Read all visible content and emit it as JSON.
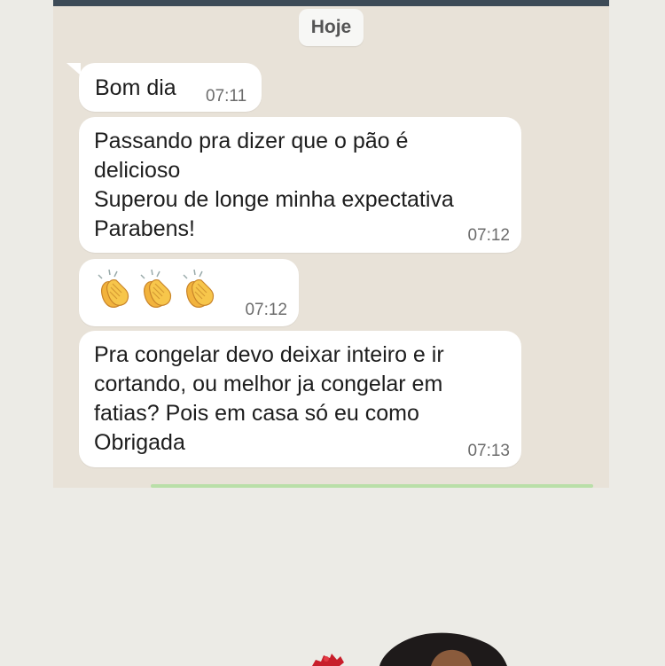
{
  "chat": {
    "date_chip": "Hoje",
    "messages": [
      {
        "text": "Bom dia",
        "time": "07:11"
      },
      {
        "text": "Passando pra dizer que o pão é\ndelicioso\nSuperou de longe minha expectativa\nParabens!",
        "time": "07:12"
      },
      {
        "text": "",
        "emoji": "clapping-hands",
        "count": 3,
        "time": "07:12"
      },
      {
        "text": "Pra congelar devo deixar inteiro e ir\ncortando, ou melhor ja congelar em\nfatias? Pois em casa só eu como\nObrigada",
        "time": "07:13"
      }
    ]
  },
  "colors": {
    "header": "#3d4b57",
    "chat_background": "#e8e2d8",
    "bubble": "#ffffff",
    "page_background": "#ecebe6",
    "accent_line": "#b9dfa8"
  }
}
